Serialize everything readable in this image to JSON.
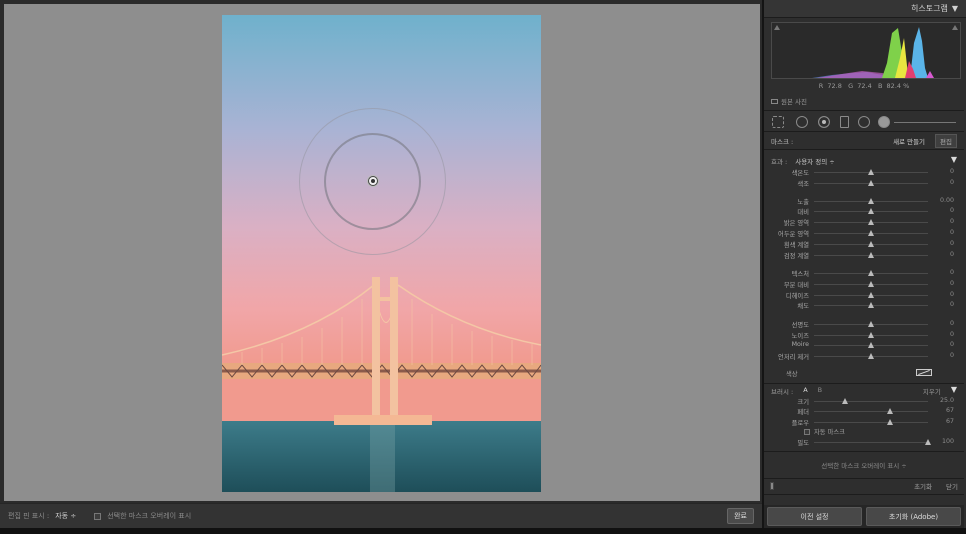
{
  "histogram": {
    "title": "히스토그램",
    "rgb": {
      "r_label": "R",
      "r_value": "72.8",
      "g_label": "G",
      "g_value": "72.4",
      "b_label": "B",
      "b_value": "82.4",
      "unit": "%"
    },
    "original_photo_label": "원본 사진"
  },
  "mask": {
    "label": "마스크 :",
    "new_label": "새로 만들기",
    "edit_label": "편집"
  },
  "effect": {
    "label": "효과 :",
    "value": "사용자 정의 ÷"
  },
  "sliders": [
    {
      "label": "색온도",
      "value": "0",
      "pos": 0.5
    },
    {
      "label": "색조",
      "value": "0",
      "pos": 0.5
    },
    {
      "label": "노출",
      "value": "0.00",
      "pos": 0.5
    },
    {
      "label": "대비",
      "value": "0",
      "pos": 0.5
    },
    {
      "label": "밝은 영역",
      "value": "0",
      "pos": 0.5
    },
    {
      "label": "어두운 영역",
      "value": "0",
      "pos": 0.5
    },
    {
      "label": "흰색 계열",
      "value": "0",
      "pos": 0.5
    },
    {
      "label": "검정 계열",
      "value": "0",
      "pos": 0.5
    },
    {
      "label": "텍스처",
      "value": "0",
      "pos": 0.5
    },
    {
      "label": "부분 대비",
      "value": "0",
      "pos": 0.5
    },
    {
      "label": "디헤이즈",
      "value": "0",
      "pos": 0.5
    },
    {
      "label": "채도",
      "value": "0",
      "pos": 0.5
    },
    {
      "label": "선명도",
      "value": "0",
      "pos": 0.5
    },
    {
      "label": "노이즈",
      "value": "0",
      "pos": 0.5
    },
    {
      "label": "Moire",
      "value": "0",
      "pos": 0.5
    },
    {
      "label": "언저리 제거",
      "value": "0",
      "pos": 0.5
    }
  ],
  "color_label": "색상",
  "brush": {
    "label": "브러시 :",
    "a": "A",
    "b": "B",
    "erase": "지우기",
    "sliders": [
      {
        "label": "크기",
        "value": "25.0",
        "pos": 0.27
      },
      {
        "label": "페더",
        "value": "67",
        "pos": 0.67
      },
      {
        "label": "플로우",
        "value": "67",
        "pos": 0.67
      }
    ],
    "auto_mask": "자동 마스크",
    "density": {
      "label": "밀도",
      "value": "100",
      "pos": 1.0
    }
  },
  "overlay_select": "선택한 마스크 오버레이 표시 ÷",
  "reset_label": "초기화",
  "close_label": "닫기",
  "buttons": {
    "previous": "이전 설정",
    "reset_adobe": "초기화 (Adobe)"
  },
  "toolbar": {
    "pin_label": "편집 핀 표시 :",
    "pin_value": "자동 ÷",
    "overlay_label": "선택한 마스크 오버레이 표시",
    "done": "완료"
  },
  "colors": {
    "panel_bg": "#2e2e2e",
    "canvas_bg": "#8e8e8e"
  }
}
